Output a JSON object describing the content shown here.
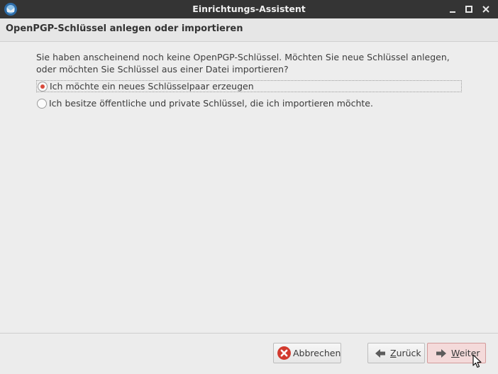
{
  "window": {
    "title": "Einrichtungs-Assistent",
    "controls": [
      "minimize-icon",
      "maximize-icon",
      "close-icon"
    ]
  },
  "header": {
    "title": "OpenPGP-Schlüssel anlegen oder importieren"
  },
  "content": {
    "description": "Sie haben anscheinend noch keine OpenPGP-Schlüssel. Möchten Sie neue Schlüssel anlegen, oder möchten Sie Schlüssel aus einer Datei importieren?",
    "options": [
      {
        "label": "Ich möchte ein neues Schlüsselpaar erzeugen",
        "selected": true
      },
      {
        "label": "Ich besitze öffentliche und private Schlüssel, die ich importieren möchte.",
        "selected": false
      }
    ]
  },
  "buttons": {
    "cancel": {
      "label": "Abbrechen",
      "icon": "cancel-icon"
    },
    "back": {
      "prefix": "",
      "mnemonic": "Z",
      "rest": "urück",
      "icon": "arrow-left-icon"
    },
    "next": {
      "mnemonic": "W",
      "rest": "eiter",
      "icon": "arrow-right-icon"
    }
  },
  "colors": {
    "titlebar": "#343434",
    "accent_radio": "#d94a3c",
    "cancel_icon": "#d23a2e",
    "next_button_bg": "#f4dada"
  }
}
